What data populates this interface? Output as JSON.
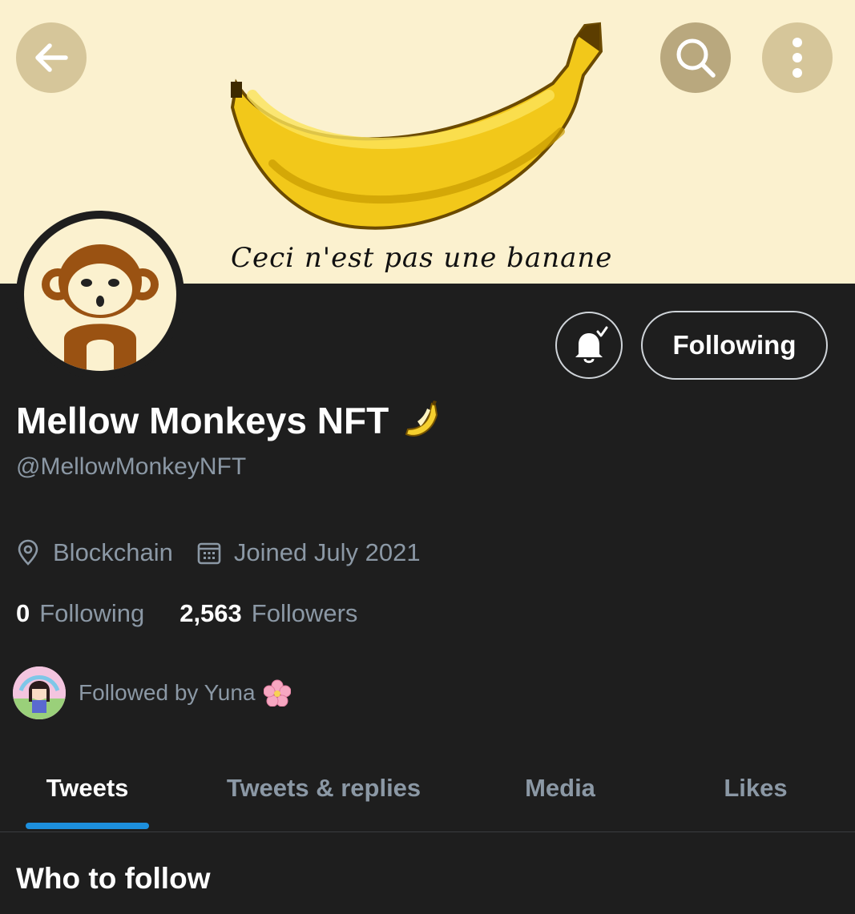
{
  "banner": {
    "caption": "Ceci n'est pas une banane"
  },
  "header": {
    "back_icon": "arrow-left-icon",
    "search_icon": "search-icon",
    "more_icon": "more-vertical-icon"
  },
  "profile": {
    "display_name": "Mellow Monkeys NFT",
    "name_emoji": "banana",
    "handle": "@MellowMonkeyNFT",
    "notify_icon": "bell-check-icon",
    "follow_button": "Following",
    "location": "Blockchain",
    "joined": "Joined July 2021",
    "following_count": "0",
    "following_label": "Following",
    "followers_count": "2,563",
    "followers_label": "Followers",
    "followed_by": "Followed by Yuna"
  },
  "tabs": [
    {
      "label": "Tweets",
      "active": true
    },
    {
      "label": "Tweets & replies",
      "active": false
    },
    {
      "label": "Media",
      "active": false
    },
    {
      "label": "Likes",
      "active": false
    }
  ],
  "section": {
    "title": "Who to follow"
  },
  "colors": {
    "background": "#1e1e1e",
    "banner": "#fbf1cf",
    "muted_text": "#8b98a5",
    "tab_indicator": "#1d8fdd"
  }
}
